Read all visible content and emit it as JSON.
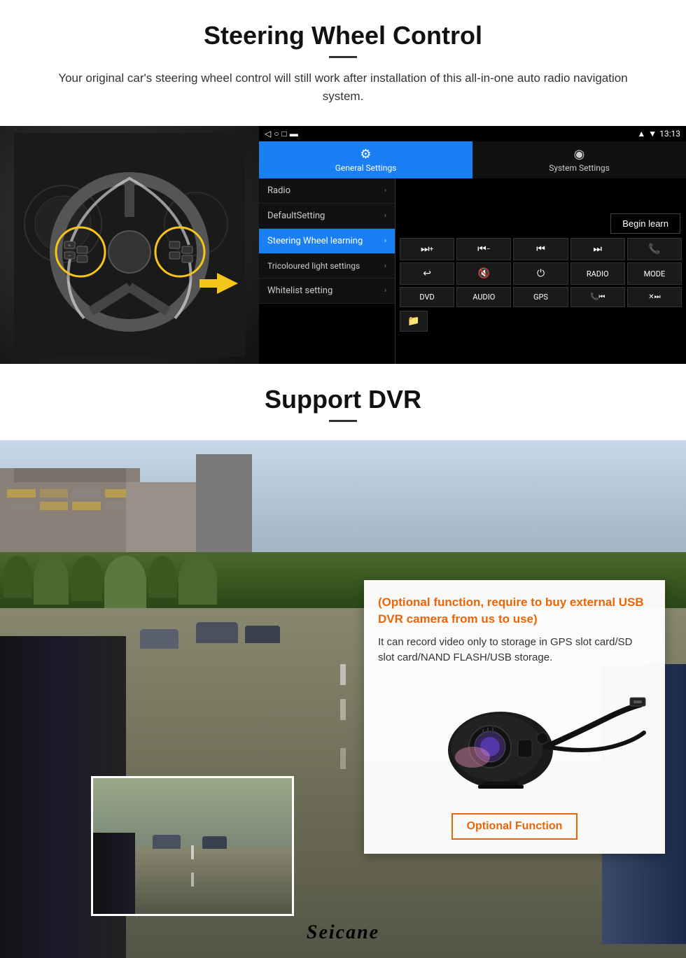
{
  "page": {
    "section1": {
      "title": "Steering Wheel Control",
      "subtitle": "Your original car's steering wheel control will still work after installation of this all-in-one auto radio navigation system.",
      "android_ui": {
        "statusbar": {
          "signal": "▼",
          "wifi": "▲",
          "time": "13:13"
        },
        "tabs": [
          {
            "label": "General Settings",
            "icon": "⚙",
            "active": true
          },
          {
            "label": "System Settings",
            "icon": "◉",
            "active": false
          }
        ],
        "menu_items": [
          {
            "label": "Radio",
            "active": false
          },
          {
            "label": "DefaultSetting",
            "active": false
          },
          {
            "label": "Steering Wheel learning",
            "active": true
          },
          {
            "label": "Tricoloured light settings",
            "active": false
          },
          {
            "label": "Whitelist setting",
            "active": false
          }
        ],
        "begin_learn": "Begin learn",
        "control_buttons_row1": [
          "⏭+",
          "⏮−",
          "⏮⏮",
          "⏭⏭",
          "📞"
        ],
        "control_buttons_row2": [
          "↩",
          "🔇",
          "⏻",
          "RADIO",
          "MODE"
        ],
        "control_buttons_row3": [
          "DVD",
          "AUDIO",
          "GPS",
          "📞⏮",
          "✕⏭"
        ]
      }
    },
    "section2": {
      "title": "Support DVR",
      "optional_text": "(Optional function, require to buy external USB DVR camera from us to use)",
      "description": "It can record video only to storage in GPS slot card/SD slot card/NAND FLASH/USB storage.",
      "optional_function_badge": "Optional Function",
      "seicane_brand": "Seicane"
    }
  }
}
